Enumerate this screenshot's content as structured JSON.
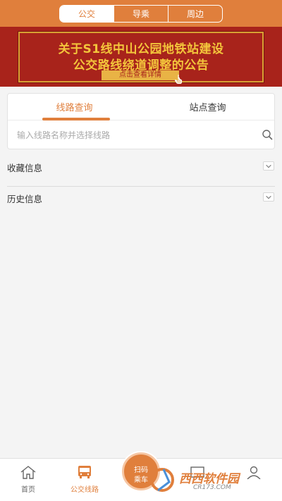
{
  "top_tabs": [
    {
      "label": "公交",
      "active": true
    },
    {
      "label": "导乘",
      "active": false
    },
    {
      "label": "周边",
      "active": false
    }
  ],
  "banner": {
    "line1": "关于S1线中山公园地铁站建设",
    "line2": "公交路线绕道调整的公告",
    "cta": "点击查看详情",
    "icon": "hand-pointer-icon"
  },
  "query_tabs": [
    {
      "label": "线路查询",
      "active": true
    },
    {
      "label": "站点查询",
      "active": false
    }
  ],
  "search": {
    "placeholder": "输入线路名称并选择线路",
    "value": "",
    "icon": "search-icon"
  },
  "sections": [
    {
      "label": "收藏信息",
      "icon": "chevron-down-icon"
    },
    {
      "label": "历史信息",
      "icon": "chevron-down-icon"
    }
  ],
  "bottom_nav": [
    {
      "label": "首页",
      "icon": "home-icon",
      "active": false
    },
    {
      "label": "公交线路",
      "icon": "bus-icon",
      "active": true
    },
    {
      "label": "",
      "icon": "message-icon",
      "active": false
    },
    {
      "label": "",
      "icon": "user-icon",
      "active": false
    }
  ],
  "scan_button": {
    "line1": "扫码",
    "line2": "乘车"
  },
  "watermark": {
    "text": "西西软件园",
    "site": "CR173.COM"
  },
  "colors": {
    "accent": "#e07f3c",
    "banner_bg": "#a8231b",
    "banner_text": "#f3c53b"
  }
}
